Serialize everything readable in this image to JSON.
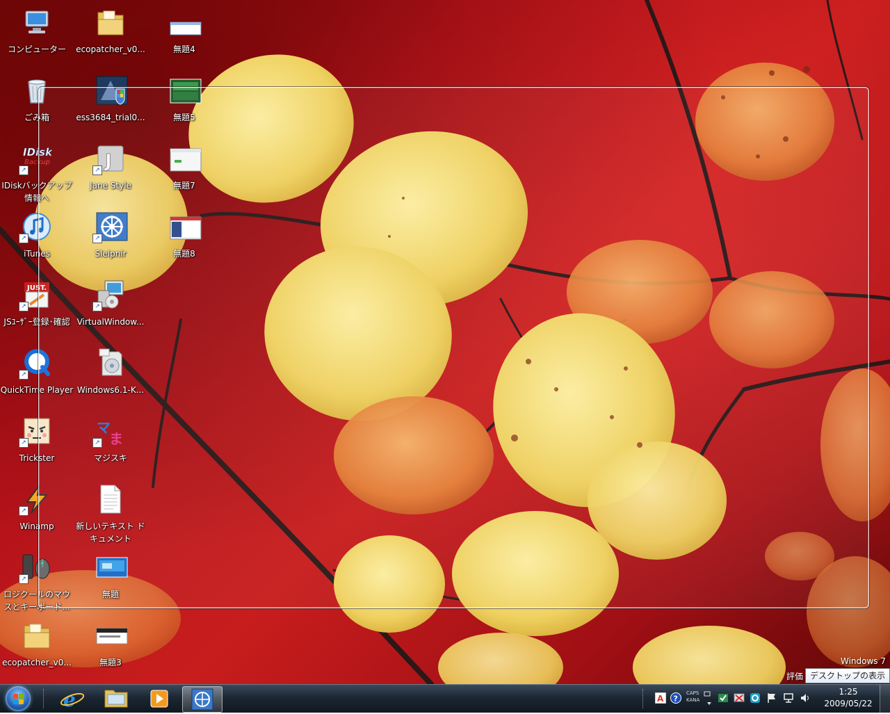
{
  "desktop_icons": {
    "computer": "コンピューター",
    "ecopatcher1": "ecopatcher_v0...",
    "untitled4": "無題4",
    "recycle": "ごみ箱",
    "ess3684": "ess3684_trial0...",
    "untitled5": "無題5",
    "idisk": "IDiskバックアップ\n情報へ",
    "janestyle": "Jane Style",
    "untitled7": "無題7",
    "itunes": "iTunes",
    "sleipnir": "Sleipnir",
    "untitled8": "無題8",
    "just": "JSﾕｰｻﾞｰ登録･確認",
    "virtualwindow": "VirtualWindow...",
    "quicktime": "QuickTime Player",
    "windows61": "Windows6.1-K...",
    "trickster": "Trickster",
    "majisuki": "マジスキ",
    "winamp": "Winamp",
    "newtext": "新しいテキスト ド\nキュメント",
    "logicool": "ロジクールのマウ\nスとキーボード...",
    "untitled": "無題",
    "ecopatcher2": "ecopatcher_v0...",
    "untitled3": "無題3"
  },
  "watermark": {
    "line1": "Windows 7",
    "line2": "評価"
  },
  "tooltip": "デスクトップの表示",
  "tray": {
    "caps": "CAPS",
    "kana": "KANA"
  },
  "clock": {
    "time": "1:25",
    "date": "2009/05/22"
  },
  "colors": {
    "taskbar": "#1c2733",
    "wallpaper_red": "#c81d1d",
    "leaf_yellow": "#f2d45a",
    "leaf_orange": "#e8873a"
  }
}
